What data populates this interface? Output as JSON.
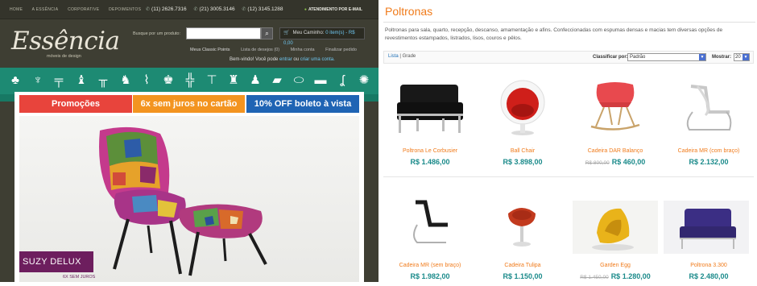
{
  "store": {
    "topnav": {
      "links": [
        "HOME",
        "A ESSÊNCIA",
        "CORPORATIVE",
        "DEPOIMENTOS"
      ],
      "phones": [
        "(11) 2626.7316",
        "(21) 3005.3146",
        "(12) 3145.1288"
      ],
      "contact": "ATENDIMENTO POR E-MAIL"
    },
    "logo": "Essência",
    "logo_sub": "móveis de design",
    "search_label": "Busque por um produto:",
    "search_value": "",
    "cart_label": "Meu Caminho:",
    "cart_value": "0 item(s) - R$ 0,00",
    "account_links": [
      "Meus Classic Points",
      "Lista de desejos (0)",
      "Minha conta",
      "Finalizar pedido"
    ],
    "welcome_pre": "Bem-vindo! Você pode",
    "welcome_login": "entrar",
    "welcome_mid": "ou",
    "welcome_create": "criar uma conta.",
    "promos": [
      {
        "label": "Promoções",
        "color": "#e8443c"
      },
      {
        "label": "6x sem juros no cartão",
        "color": "#f39420"
      },
      {
        "label": "10% OFF boleto à vista",
        "color": "#1f64b4"
      }
    ],
    "hero_title": "SUZY DELUX",
    "hero_sub": "6X SEM JUROS",
    "accent_teal": "#1d8a73"
  },
  "catalog": {
    "title": "Poltronas",
    "description": "Poltronas para sala, quarto, recepção, descanso, amamentação e afins. Confeccionadas com espumas densas e macias tem diversas opções de revestimentos estampados, listrados, lisos, couros e pêlos.",
    "view_list": "Lista",
    "view_sep": "|",
    "view_grid": "Grade",
    "sort_label": "Classificar por:",
    "sort_value": "Padrão",
    "show_label": "Mostrar:",
    "show_value": "20",
    "products": [
      {
        "name": "Poltrona Le Corbusier",
        "price": "R$ 1.486,00",
        "old": ""
      },
      {
        "name": "Ball Chair",
        "price": "R$ 3.898,00",
        "old": ""
      },
      {
        "name": "Cadeira DAR Balanço",
        "price": "R$ 460,00",
        "old": "R$ 800,00"
      },
      {
        "name": "Cadeira MR (com braço)",
        "price": "R$ 2.132,00",
        "old": ""
      },
      {
        "name": "Cadeira MR (sem braço)",
        "price": "R$ 1.982,00",
        "old": ""
      },
      {
        "name": "Cadeira Tulipa",
        "price": "R$ 1.150,00",
        "old": ""
      },
      {
        "name": "Garden Egg",
        "price": "R$ 1.280,00",
        "old": "R$ 1.450,00"
      },
      {
        "name": "Poltrona 3.300",
        "price": "R$ 2.480,00",
        "old": ""
      }
    ]
  }
}
